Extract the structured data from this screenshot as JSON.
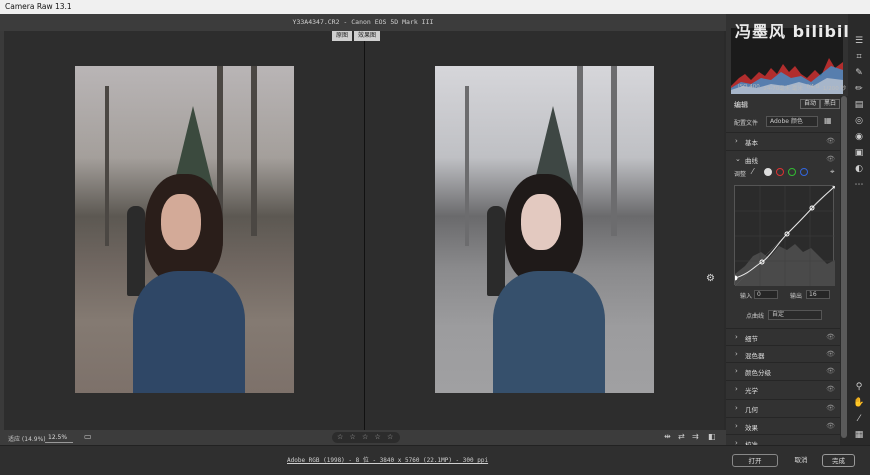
{
  "window": {
    "title": "Camera Raw 13.1"
  },
  "file_info": "Y33A4347.CR2 - Canon EOS 5D Mark III",
  "view_toggle": {
    "before": "原图",
    "after": "效果图"
  },
  "bottom_bar": {
    "zoom_label": "适应 (14.9%)",
    "zoom_value": "12.5%",
    "rating": "☆ ☆ ☆ ☆ ☆"
  },
  "footer": {
    "image_info_link": "Adobe RGB (1998) - 8 位 - 3840 x 5760 (22.1MP) - 300 ppi",
    "open_button": "打开",
    "cancel_button": "取消",
    "done_button": "完成"
  },
  "watermark": "冯墨风 bilibili",
  "histogram_info": {
    "iso": "ISO 400",
    "lens": "24-70毫米 毫米",
    "aperture": "f/4.0",
    "shutter": "1/200 秒"
  },
  "edit": {
    "title": "编辑",
    "auto_button": "自动",
    "bw_button": "黑白"
  },
  "profile": {
    "label": "配置文件",
    "value": "Adobe 颜色"
  },
  "sections": [
    {
      "label": "基本",
      "chev": "›"
    },
    {
      "label": "曲线",
      "chev": "⌄"
    }
  ],
  "curve": {
    "adjust_label": "调整",
    "input_label": "输入",
    "input_value": "0",
    "output_label": "输出",
    "output_value": "16",
    "point_curve_label": "点曲线",
    "point_curve_value": "自定"
  },
  "lower_sections": [
    {
      "label": "细节"
    },
    {
      "label": "混色器"
    },
    {
      "label": "颜色分级"
    },
    {
      "label": "光学"
    },
    {
      "label": "几何"
    },
    {
      "label": "效果"
    },
    {
      "label": "校准"
    }
  ],
  "colors": {
    "panel": "#323232",
    "canvas": "#2d2d2d",
    "accent": "#cfcfcf"
  }
}
